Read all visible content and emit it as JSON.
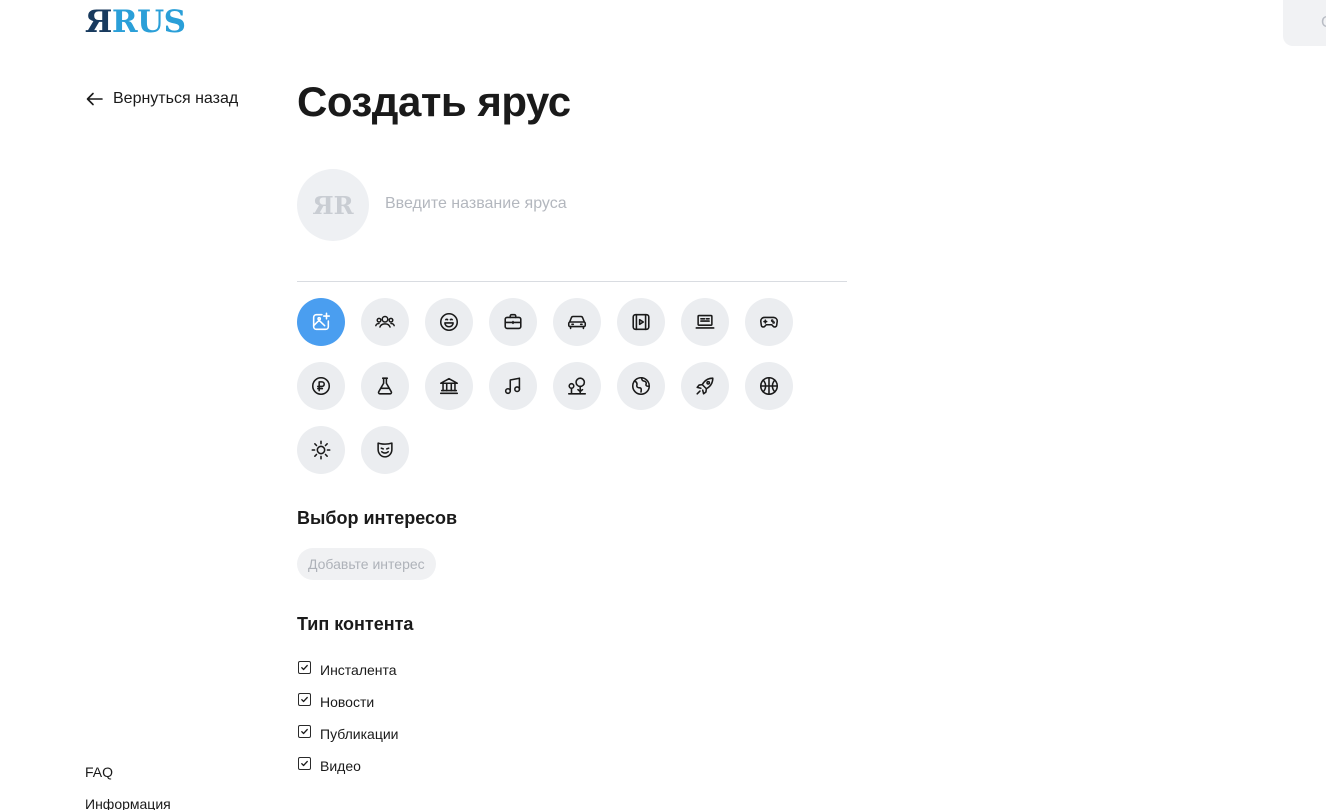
{
  "logo": {
    "part1": "Я",
    "part2": "RUS"
  },
  "top_right": {
    "glyph": "С"
  },
  "nav": {
    "back_label": "Вернуться назад"
  },
  "page": {
    "title": "Создать ярус"
  },
  "avatar": {
    "placeholder_glyph": "ЯR"
  },
  "name_input": {
    "placeholder": "Введите название яруса",
    "value": ""
  },
  "icons": [
    {
      "name": "image-add-icon",
      "active": true
    },
    {
      "name": "people-icon",
      "active": false
    },
    {
      "name": "smile-icon",
      "active": false
    },
    {
      "name": "briefcase-icon",
      "active": false
    },
    {
      "name": "car-icon",
      "active": false
    },
    {
      "name": "video-icon",
      "active": false
    },
    {
      "name": "laptop-icon",
      "active": false
    },
    {
      "name": "gamepad-icon",
      "active": false
    },
    {
      "name": "ruble-icon",
      "active": false
    },
    {
      "name": "flask-icon",
      "active": false
    },
    {
      "name": "bank-icon",
      "active": false
    },
    {
      "name": "music-icon",
      "active": false
    },
    {
      "name": "nature-icon",
      "active": false
    },
    {
      "name": "globe-icon",
      "active": false
    },
    {
      "name": "rocket-icon",
      "active": false
    },
    {
      "name": "basketball-icon",
      "active": false
    },
    {
      "name": "sun-icon",
      "active": false
    },
    {
      "name": "theater-mask-icon",
      "active": false
    }
  ],
  "interests": {
    "title": "Выбор интересов",
    "add_label": "Добавьте интерес"
  },
  "content_type": {
    "title": "Тип контента",
    "items": [
      {
        "label": "Инсталента",
        "checked": true
      },
      {
        "label": "Новости",
        "checked": true
      },
      {
        "label": "Публикации",
        "checked": true
      },
      {
        "label": "Видео",
        "checked": true
      }
    ]
  },
  "footer": {
    "links": [
      "FAQ",
      "Информация"
    ]
  },
  "colors": {
    "accent": "#4a9ef0",
    "logo_dark": "#183a5e",
    "logo_light": "#2a9fd8"
  }
}
